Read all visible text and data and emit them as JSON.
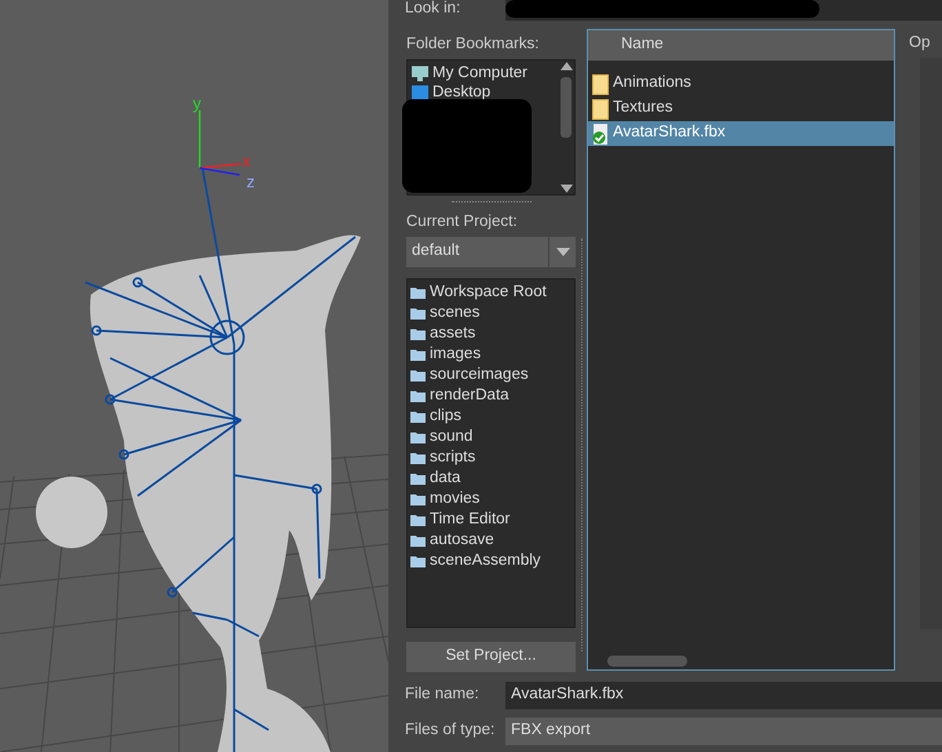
{
  "viewport": {
    "axis_labels": [
      {
        "kind": "y",
        "text": "y"
      },
      {
        "kind": "x",
        "text": "x"
      },
      {
        "kind": "z",
        "text": "z"
      }
    ]
  },
  "dialog": {
    "look_in": {
      "label": "Look in:"
    },
    "bookmarks": {
      "label": "Folder Bookmarks:",
      "items": [
        {
          "label": "My Computer",
          "kind": "computer"
        },
        {
          "label": "Desktop",
          "kind": "desktop"
        }
      ]
    },
    "current_project": {
      "label": "Current Project:",
      "value": "default"
    },
    "project_folders": [
      "Workspace Root",
      "scenes",
      "assets",
      "images",
      "sourceimages",
      "renderData",
      "clips",
      "sound",
      "scripts",
      "data",
      "movies",
      "Time Editor",
      "autosave",
      "sceneAssembly"
    ],
    "set_project_button": "Set Project...",
    "file_list": {
      "columns": [
        "Name"
      ],
      "items": [
        {
          "name": "Animations",
          "kind": "folder",
          "selected": false
        },
        {
          "name": "Textures",
          "kind": "folder",
          "selected": false
        },
        {
          "name": "AvatarShark.fbx",
          "kind": "file",
          "selected": true
        }
      ]
    },
    "options_label": "Op",
    "file_name": {
      "label": "File name:",
      "value": "AvatarShark.fbx"
    },
    "file_type": {
      "label": "Files of type:",
      "value": "FBX export"
    }
  }
}
